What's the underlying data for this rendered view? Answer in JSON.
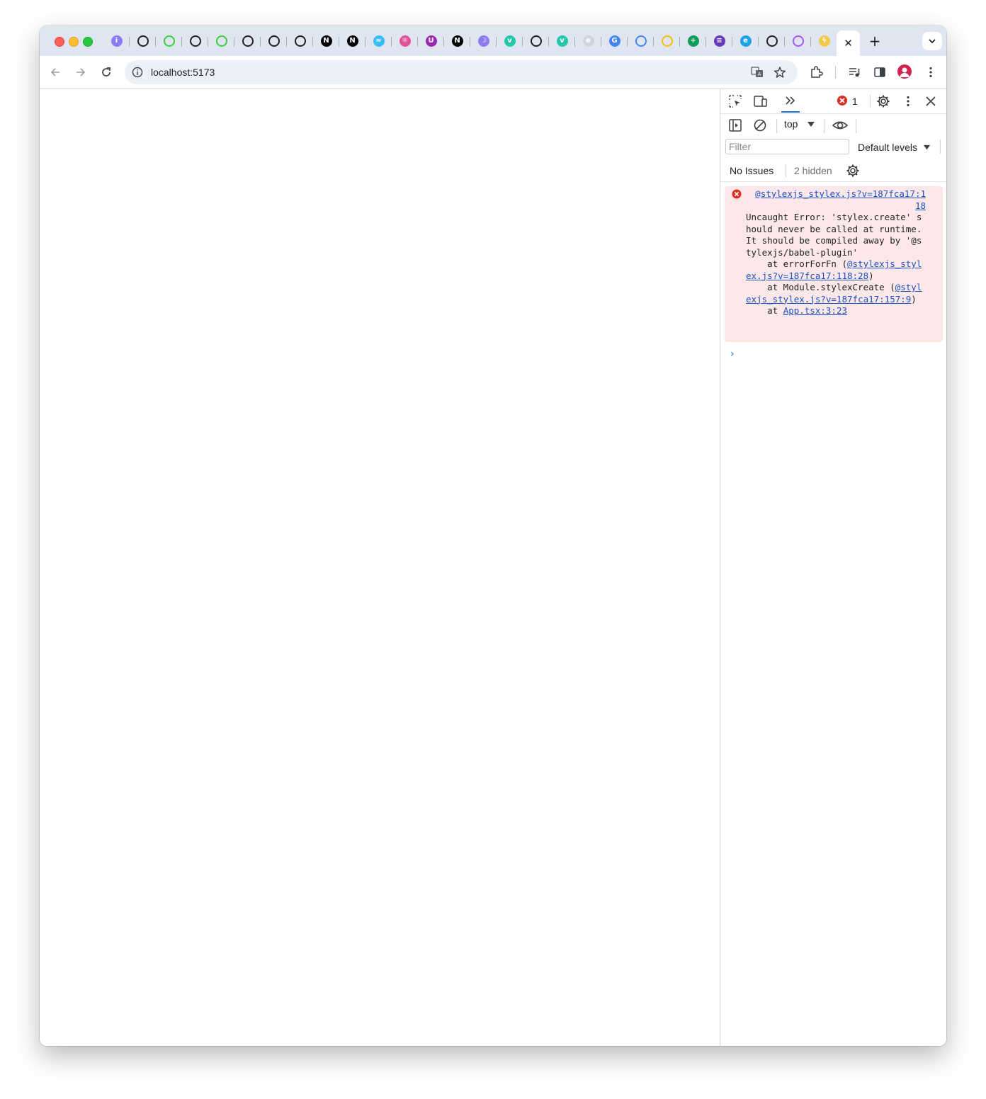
{
  "browser": {
    "tabs": [
      {
        "icon": "bookmark-icon",
        "glyph": "i",
        "color": "#8b7cf6"
      },
      {
        "icon": "github-icon",
        "glyph": "",
        "color": "#1f1f1f"
      },
      {
        "icon": "globe-green-icon",
        "glyph": "",
        "color": "#3ad13a"
      },
      {
        "icon": "github-icon",
        "glyph": "",
        "color": "#1f1f1f"
      },
      {
        "icon": "globe-green-icon",
        "glyph": "",
        "color": "#3ad13a"
      },
      {
        "icon": "github-icon",
        "glyph": "",
        "color": "#1f1f1f"
      },
      {
        "icon": "chat-bot-icon",
        "glyph": "",
        "color": "#1f1f1f"
      },
      {
        "icon": "asterisk-icon",
        "glyph": "",
        "color": "#1f1f1f"
      },
      {
        "icon": "nextjs-icon",
        "glyph": "N",
        "color": "#000000"
      },
      {
        "icon": "nextjs-icon",
        "glyph": "N",
        "color": "#000000"
      },
      {
        "icon": "tailwind-icon",
        "glyph": "≈",
        "color": "#38bdf8"
      },
      {
        "icon": "react-icon",
        "glyph": "⚛",
        "color": "#e0529c"
      },
      {
        "icon": "upstash-icon",
        "glyph": "U",
        "color": "#9c27b0"
      },
      {
        "icon": "nextjs-icon",
        "glyph": "N",
        "color": "#000000"
      },
      {
        "icon": "moon-icon",
        "glyph": "☽",
        "color": "#8e7cf3"
      },
      {
        "icon": "vue-v-icon",
        "glyph": "v",
        "color": "#21c7a8"
      },
      {
        "icon": "paw-icon",
        "glyph": "",
        "color": "#1f1f1f"
      },
      {
        "icon": "vue-v-icon",
        "glyph": "v",
        "color": "#21c7a8"
      },
      {
        "icon": "edge-light-icon",
        "glyph": "e",
        "color": "#d0d5de"
      },
      {
        "icon": "google-icon",
        "glyph": "G",
        "color": "#4285f4"
      },
      {
        "icon": "docs-icon",
        "glyph": "",
        "color": "#4285f4"
      },
      {
        "icon": "drive-icon",
        "glyph": "",
        "color": "#fbbc04"
      },
      {
        "icon": "sheets-icon",
        "glyph": "+",
        "color": "#0f9d58"
      },
      {
        "icon": "forms-icon",
        "glyph": "≡",
        "color": "#673ab7"
      },
      {
        "icon": "edge-icon",
        "glyph": "e",
        "color": "#1fa1e6"
      },
      {
        "icon": "speaker-icon",
        "glyph": "",
        "color": "#1f1f1f"
      },
      {
        "icon": "vite-icon",
        "glyph": "",
        "color": "#a855f7"
      },
      {
        "icon": "bolt-icon",
        "glyph": "ϟ",
        "color": "#f7c948"
      }
    ],
    "active_tab_close": "✕",
    "new_tab": "+",
    "url": "localhost:5173"
  },
  "devtools": {
    "error_count": "1",
    "context": "top",
    "filter_placeholder": "Filter",
    "levels": "Default levels",
    "no_issues": "No Issues",
    "hidden": "2 hidden",
    "error": {
      "source": "@stylexjs_stylex.js?v=187fca17:118",
      "message": "Uncaught Error: 'stylex.create' should never be called at runtime. It should be compiled away by '@stylexjs/babel-plugin'",
      "line1_prefix": "    at errorForFn (",
      "line1_link": "@stylexjs_stylex.js?v=187fca17:118:28",
      "line1_suffix": ")",
      "line2_prefix": "    at Module.stylexCreate (",
      "line2_link": "@stylexjs_stylex.js?v=187fca17:157:9",
      "line2_suffix": ")",
      "line3_prefix": "    at ",
      "line3_link": "App.tsx:3:23"
    },
    "prompt": "›"
  }
}
